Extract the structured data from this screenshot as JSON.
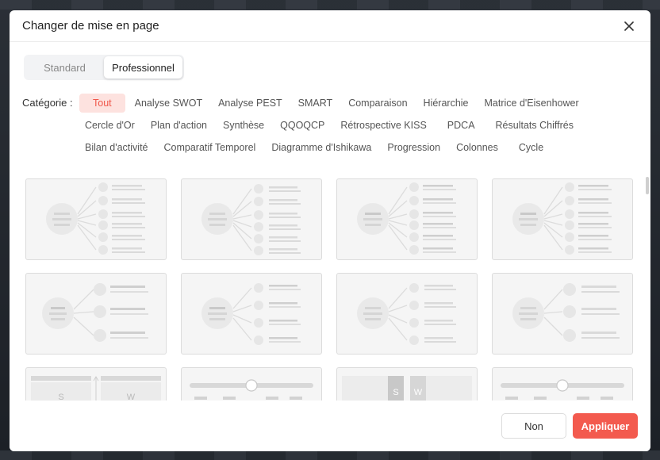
{
  "dialog": {
    "title": "Changer de mise en page"
  },
  "tabs": [
    {
      "label": "Standard",
      "active": false
    },
    {
      "label": "Professionnel",
      "active": true
    }
  ],
  "category": {
    "label": "Catégorie :",
    "rows": [
      [
        "Tout",
        "Analyse SWOT",
        "Analyse PEST",
        "SMART",
        "Comparaison",
        "Hiérarchie",
        "Matrice d'Eisenhower"
      ],
      [
        "Cercle d'Or",
        "Plan d'action",
        "Synthèse",
        "QQOQCP",
        "Rétrospective KISS",
        "PDCA",
        "Résultats Chiffrés"
      ],
      [
        "Bilan d'activité",
        "Comparatif Temporel",
        "Diagramme d'Ishikawa",
        "Progression",
        "Colonnes",
        "Cycle"
      ]
    ],
    "active": "Tout"
  },
  "templates": {
    "swot_letters": [
      "S",
      "W"
    ]
  },
  "footer": {
    "no_label": "Non",
    "apply_label": "Appliquer"
  },
  "colors": {
    "accent": "#f35a4e",
    "accent_bg": "#fde2df",
    "card_bg": "#f5f5f5",
    "placeholder": "#dcdcdc"
  }
}
